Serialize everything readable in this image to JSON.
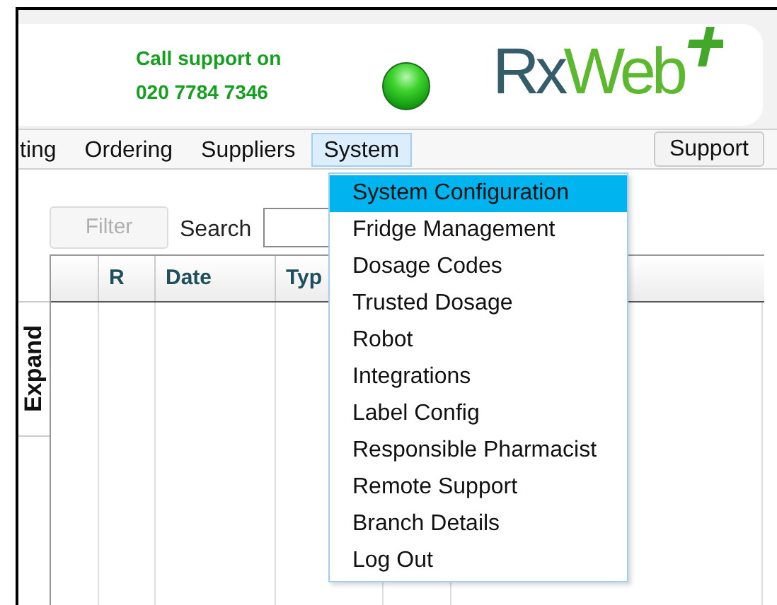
{
  "header": {
    "support_lines": [
      "Call support on",
      "020 7784 7346"
    ],
    "logo": {
      "part_1": "Rx",
      "part_2": "Web"
    }
  },
  "menu_bar": {
    "items": [
      {
        "label": "ting",
        "selected": false
      },
      {
        "label": "Ordering",
        "selected": false
      },
      {
        "label": "Suppliers",
        "selected": false
      },
      {
        "label": "System",
        "selected": true
      }
    ],
    "support_button": "Support"
  },
  "toolbar": {
    "filter_button": {
      "label": "Filter",
      "disabled": true
    },
    "search_label": "Search"
  },
  "side_tab": "Expand",
  "table": {
    "columns": [
      "R",
      "Date",
      "Typ"
    ]
  },
  "dropdown": [
    {
      "label": "System Configuration",
      "selected": true
    },
    {
      "label": "Fridge Management",
      "selected": false
    },
    {
      "label": "Dosage Codes",
      "selected": false
    },
    {
      "label": "Trusted Dosage",
      "selected": false
    },
    {
      "label": "Robot",
      "selected": false
    },
    {
      "label": "Integrations",
      "selected": false
    },
    {
      "label": "Label Config",
      "selected": false
    },
    {
      "label": "Responsible Pharmacist",
      "selected": false
    },
    {
      "label": "Remote Support",
      "selected": false
    },
    {
      "label": "Branch Details",
      "selected": false
    },
    {
      "label": "Log Out",
      "selected": false
    }
  ]
}
